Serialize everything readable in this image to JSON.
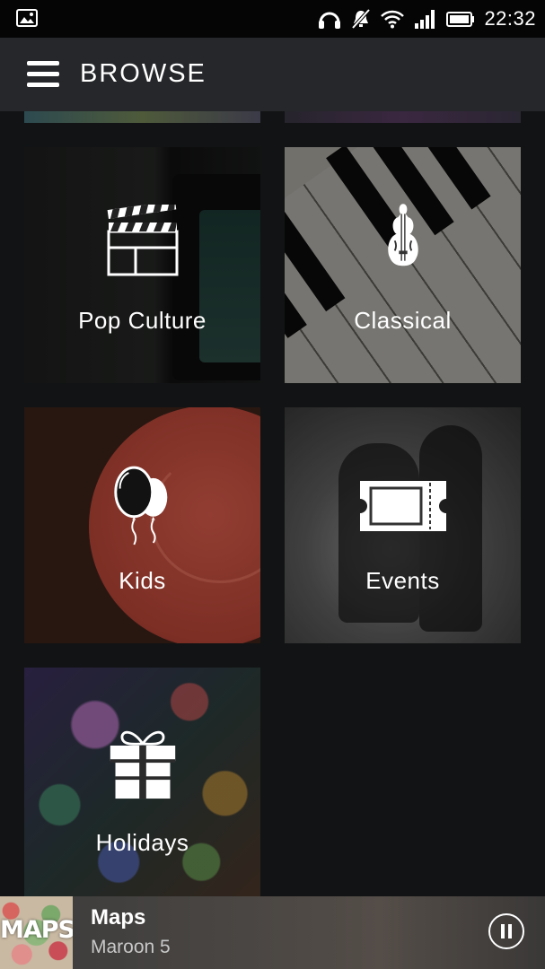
{
  "status_bar": {
    "time": "22:32",
    "icons": [
      "image-notification-icon",
      "headphones-icon",
      "mute-icon",
      "wifi-icon",
      "signal-icon",
      "battery-icon"
    ]
  },
  "header": {
    "title": "BROWSE",
    "menu_icon": "hamburger-menu-icon"
  },
  "categories": [
    {
      "label": "Pop Culture",
      "icon": "clapperboard-icon"
    },
    {
      "label": "Classical",
      "icon": "violin-icon"
    },
    {
      "label": "Kids",
      "icon": "balloons-icon"
    },
    {
      "label": "Events",
      "icon": "ticket-icon"
    },
    {
      "label": "Holidays",
      "icon": "gift-icon"
    }
  ],
  "now_playing": {
    "cover_text": "MAPS",
    "title": "Maps",
    "artist": "Maroon 5",
    "control_icon": "pause-icon"
  },
  "colors": {
    "background": "#121314",
    "app_bar": "#25272a",
    "status_bar": "#050505"
  }
}
